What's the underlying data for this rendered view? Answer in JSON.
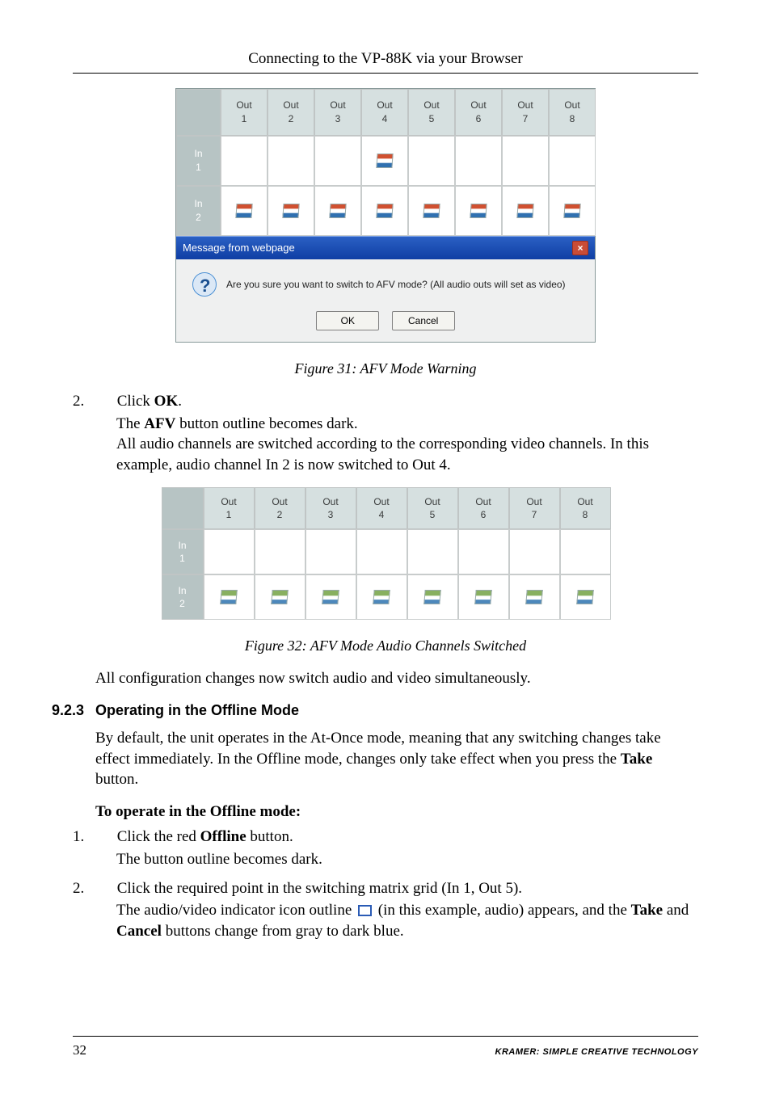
{
  "running_head": "Connecting to the VP-88K via your Browser",
  "matrix": {
    "out_lbl": "Out",
    "in_lbl": "In",
    "cols": [
      "1",
      "2",
      "3",
      "4",
      "5",
      "6",
      "7",
      "8"
    ],
    "rows": [
      "1",
      "2"
    ]
  },
  "chart_data": [
    {
      "type": "table",
      "title": "Figure 31 switching matrix (video/audio indicator present = true)",
      "columns": [
        "Out 1",
        "Out 2",
        "Out 3",
        "Out 4",
        "Out 5",
        "Out 6",
        "Out 7",
        "Out 8"
      ],
      "rows": [
        "In 1",
        "In 2"
      ],
      "data": [
        [
          false,
          false,
          false,
          true,
          false,
          false,
          false,
          false
        ],
        [
          true,
          true,
          true,
          true,
          true,
          true,
          true,
          true
        ]
      ]
    },
    {
      "type": "table",
      "title": "Figure 32 audio switching matrix after AFV (audio indicator present = true)",
      "columns": [
        "Out 1",
        "Out 2",
        "Out 3",
        "Out 4",
        "Out 5",
        "Out 6",
        "Out 7",
        "Out 8"
      ],
      "rows": [
        "In 1",
        "In 2"
      ],
      "data": [
        [
          false,
          false,
          false,
          false,
          false,
          false,
          false,
          false
        ],
        [
          true,
          true,
          true,
          true,
          true,
          true,
          true,
          true
        ]
      ]
    }
  ],
  "dialog": {
    "title": "Message from webpage",
    "text": "Are you sure you want to switch to AFV mode? (All audio outs will set as video)",
    "ok": "OK",
    "cancel": "Cancel"
  },
  "fig31_cap": "Figure 31: AFV Mode Warning",
  "step2_num": "2.",
  "step2_a": "Click ",
  "step2_b": "OK",
  "step2_c": ".",
  "step2_line2a": "The ",
  "step2_line2b": "AFV",
  "step2_line2c": " button outline becomes dark.",
  "step2_line3": "All audio channels are switched according to the corresponding video channels. In this example, audio channel In 2 is now switched to Out 4.",
  "fig32_cap": "Figure 32: AFV Mode Audio Channels Switched",
  "after_fig32": "All configuration changes now switch audio and video simultaneously.",
  "sec_num": "9.2.3",
  "sec_title": "Operating in the Offline Mode",
  "sec_para_a": "By default, the unit operates in the At-Once mode, meaning that any switching changes take effect immediately. In the Offline mode, changes only take effect when you press the ",
  "sec_para_b": "Take",
  "sec_para_c": " button.",
  "sub_head": "To operate in the Offline mode:",
  "s1_num": "1.",
  "s1a": "Click the red ",
  "s1b": "Offline",
  "s1c": " button.",
  "s1_line2": "The button outline becomes dark.",
  "s2_num": "2.",
  "s2_text": "Click the required point in the switching matrix grid (In 1, Out 5).",
  "s2b_a": "The audio/video indicator icon outline ",
  "s2b_b": " (in this example, audio) appears, and the ",
  "s2b_c": "Take",
  "s2b_d": " and ",
  "s2b_e": "Cancel",
  "s2b_f": " buttons change from gray to dark blue.",
  "page_num": "32",
  "brand": "KRAMER:  SIMPLE CREATIVE TECHNOLOGY"
}
